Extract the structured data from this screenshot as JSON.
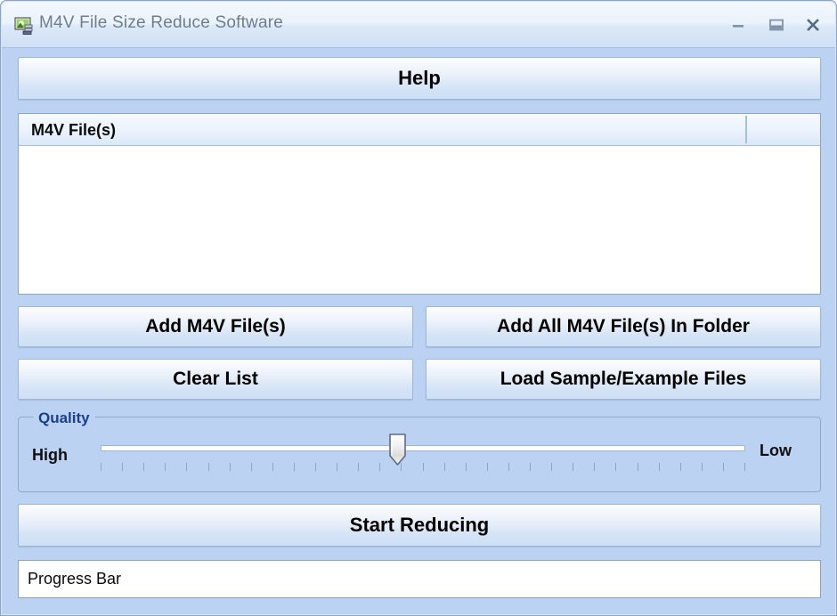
{
  "window": {
    "title": "M4V File Size Reduce Software",
    "icon": "app-video-icon",
    "controls": {
      "minimize": "minimize-icon",
      "maximize": "maximize-icon",
      "close": "close-icon"
    }
  },
  "toolbar": {
    "help_label": "Help"
  },
  "file_list": {
    "column_header": "M4V File(s)",
    "rows": []
  },
  "actions": {
    "add_files": "Add M4V File(s)",
    "add_folder": "Add All M4V File(s) In Folder",
    "clear_list": "Clear List",
    "load_sample": "Load Sample/Example Files",
    "start": "Start Reducing"
  },
  "quality": {
    "legend": "Quality",
    "min_label": "High",
    "max_label": "Low",
    "value_percent": 46,
    "tick_count": 31
  },
  "status": {
    "progress_label": "Progress Bar",
    "progress_percent": 0
  },
  "colors": {
    "window_background": "#bcd2f2",
    "button_face": "#e2ecf8",
    "border": "#8ba4c4",
    "legend_text": "#1b3f8f",
    "title_text": "#6e7d8f"
  }
}
